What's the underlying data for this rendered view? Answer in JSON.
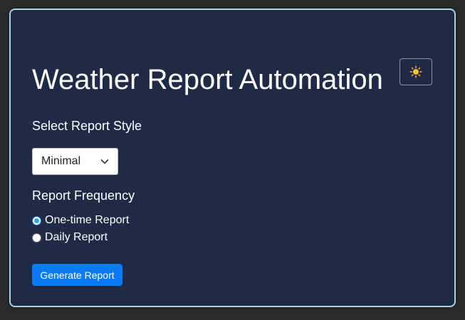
{
  "header": {
    "title": "Weather Report Automation",
    "theme_toggle_icon": "sun-icon"
  },
  "report_style": {
    "label": "Select Report Style",
    "selected": "Minimal",
    "icon": "chevron-down-icon"
  },
  "report_frequency": {
    "label": "Report Frequency",
    "options": [
      {
        "label": "One-time Report",
        "checked": true
      },
      {
        "label": "Daily Report",
        "checked": false
      }
    ]
  },
  "actions": {
    "generate_label": "Generate Report"
  },
  "colors": {
    "page_bg": "#2a2c2e",
    "card_bg": "#1f2a47",
    "card_border": "#a9d4e6",
    "primary_button": "#0b7bf5",
    "text": "#ffffff"
  }
}
